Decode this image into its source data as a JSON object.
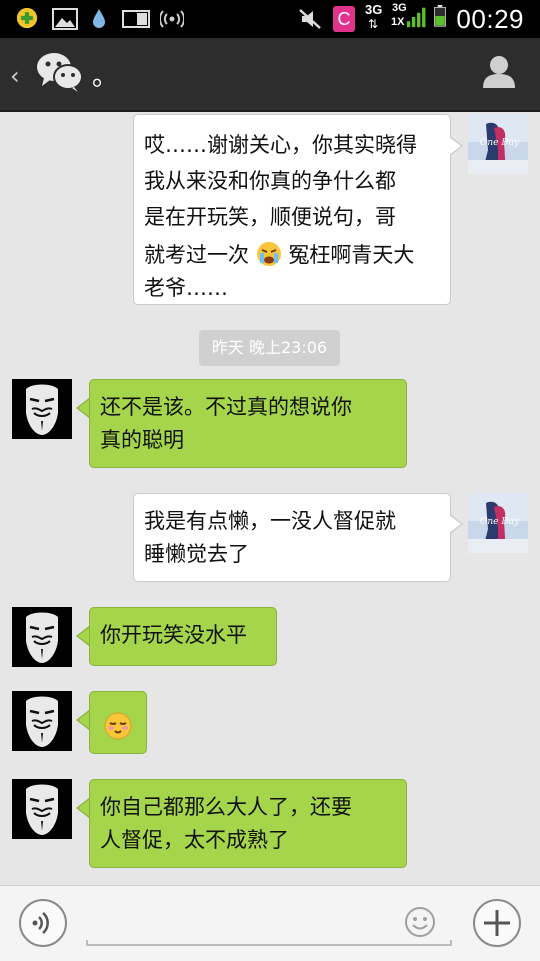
{
  "status_bar": {
    "time": "00:29",
    "network_type": "3G",
    "network_type_2": "3G",
    "network_sub": "1X",
    "carrier_icon_letter": "C"
  },
  "header": {
    "title": "。",
    "icon": "wechat-bubbles-icon",
    "contact_icon": "person-icon"
  },
  "messages": [
    {
      "side": "out",
      "lines": [
        "哎……谢谢关心，你其实晓得",
        "我从来没和你真的争什么都",
        "是在开玩笑，顺便说句，哥"
      ],
      "line4_before": "就考过一次",
      "line4_after": "冤枉啊青天大",
      "line5": "老爷……"
    },
    {
      "side": "in",
      "lines": [
        "还不是该。不过真的想说你",
        "真的聪明"
      ]
    },
    {
      "side": "out",
      "lines": [
        "我是有点懒，一没人督促就",
        "睡懒觉去了"
      ]
    },
    {
      "side": "in",
      "lines": [
        "你开玩笑没水平"
      ]
    },
    {
      "side": "in",
      "emoji": "relieved-face-emoji"
    },
    {
      "side": "in",
      "lines": [
        "你自己都那么大人了，还要",
        "人督促，太不成熟了"
      ]
    }
  ],
  "timestamp": "昨天 晚上23:06",
  "avatar_out_caption": "One Day",
  "input_bar": {
    "placeholder": "",
    "voice_icon": "voice-icon",
    "emoji_icon": "smiley-icon",
    "plus_icon": "plus-icon"
  },
  "colors": {
    "incoming_bubble": "#a4d54a",
    "outgoing_bubble": "#ffffff",
    "header_bg": "#2d2d2d",
    "chat_bg": "#e6e6e6"
  }
}
